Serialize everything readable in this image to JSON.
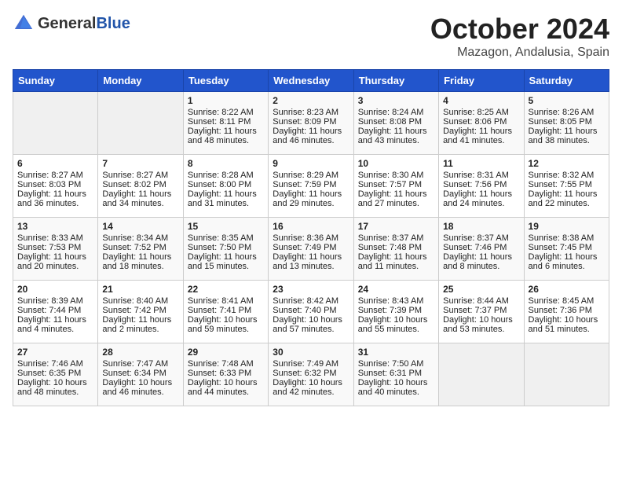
{
  "header": {
    "logo_general": "General",
    "logo_blue": "Blue",
    "month_title": "October 2024",
    "location": "Mazagon, Andalusia, Spain"
  },
  "weekdays": [
    "Sunday",
    "Monday",
    "Tuesday",
    "Wednesday",
    "Thursday",
    "Friday",
    "Saturday"
  ],
  "weeks": [
    [
      {
        "day": "",
        "sunrise": "",
        "sunset": "",
        "daylight": ""
      },
      {
        "day": "",
        "sunrise": "",
        "sunset": "",
        "daylight": ""
      },
      {
        "day": "1",
        "sunrise": "Sunrise: 8:22 AM",
        "sunset": "Sunset: 8:11 PM",
        "daylight": "Daylight: 11 hours and 48 minutes."
      },
      {
        "day": "2",
        "sunrise": "Sunrise: 8:23 AM",
        "sunset": "Sunset: 8:09 PM",
        "daylight": "Daylight: 11 hours and 46 minutes."
      },
      {
        "day": "3",
        "sunrise": "Sunrise: 8:24 AM",
        "sunset": "Sunset: 8:08 PM",
        "daylight": "Daylight: 11 hours and 43 minutes."
      },
      {
        "day": "4",
        "sunrise": "Sunrise: 8:25 AM",
        "sunset": "Sunset: 8:06 PM",
        "daylight": "Daylight: 11 hours and 41 minutes."
      },
      {
        "day": "5",
        "sunrise": "Sunrise: 8:26 AM",
        "sunset": "Sunset: 8:05 PM",
        "daylight": "Daylight: 11 hours and 38 minutes."
      }
    ],
    [
      {
        "day": "6",
        "sunrise": "Sunrise: 8:27 AM",
        "sunset": "Sunset: 8:03 PM",
        "daylight": "Daylight: 11 hours and 36 minutes."
      },
      {
        "day": "7",
        "sunrise": "Sunrise: 8:27 AM",
        "sunset": "Sunset: 8:02 PM",
        "daylight": "Daylight: 11 hours and 34 minutes."
      },
      {
        "day": "8",
        "sunrise": "Sunrise: 8:28 AM",
        "sunset": "Sunset: 8:00 PM",
        "daylight": "Daylight: 11 hours and 31 minutes."
      },
      {
        "day": "9",
        "sunrise": "Sunrise: 8:29 AM",
        "sunset": "Sunset: 7:59 PM",
        "daylight": "Daylight: 11 hours and 29 minutes."
      },
      {
        "day": "10",
        "sunrise": "Sunrise: 8:30 AM",
        "sunset": "Sunset: 7:57 PM",
        "daylight": "Daylight: 11 hours and 27 minutes."
      },
      {
        "day": "11",
        "sunrise": "Sunrise: 8:31 AM",
        "sunset": "Sunset: 7:56 PM",
        "daylight": "Daylight: 11 hours and 24 minutes."
      },
      {
        "day": "12",
        "sunrise": "Sunrise: 8:32 AM",
        "sunset": "Sunset: 7:55 PM",
        "daylight": "Daylight: 11 hours and 22 minutes."
      }
    ],
    [
      {
        "day": "13",
        "sunrise": "Sunrise: 8:33 AM",
        "sunset": "Sunset: 7:53 PM",
        "daylight": "Daylight: 11 hours and 20 minutes."
      },
      {
        "day": "14",
        "sunrise": "Sunrise: 8:34 AM",
        "sunset": "Sunset: 7:52 PM",
        "daylight": "Daylight: 11 hours and 18 minutes."
      },
      {
        "day": "15",
        "sunrise": "Sunrise: 8:35 AM",
        "sunset": "Sunset: 7:50 PM",
        "daylight": "Daylight: 11 hours and 15 minutes."
      },
      {
        "day": "16",
        "sunrise": "Sunrise: 8:36 AM",
        "sunset": "Sunset: 7:49 PM",
        "daylight": "Daylight: 11 hours and 13 minutes."
      },
      {
        "day": "17",
        "sunrise": "Sunrise: 8:37 AM",
        "sunset": "Sunset: 7:48 PM",
        "daylight": "Daylight: 11 hours and 11 minutes."
      },
      {
        "day": "18",
        "sunrise": "Sunrise: 8:37 AM",
        "sunset": "Sunset: 7:46 PM",
        "daylight": "Daylight: 11 hours and 8 minutes."
      },
      {
        "day": "19",
        "sunrise": "Sunrise: 8:38 AM",
        "sunset": "Sunset: 7:45 PM",
        "daylight": "Daylight: 11 hours and 6 minutes."
      }
    ],
    [
      {
        "day": "20",
        "sunrise": "Sunrise: 8:39 AM",
        "sunset": "Sunset: 7:44 PM",
        "daylight": "Daylight: 11 hours and 4 minutes."
      },
      {
        "day": "21",
        "sunrise": "Sunrise: 8:40 AM",
        "sunset": "Sunset: 7:42 PM",
        "daylight": "Daylight: 11 hours and 2 minutes."
      },
      {
        "day": "22",
        "sunrise": "Sunrise: 8:41 AM",
        "sunset": "Sunset: 7:41 PM",
        "daylight": "Daylight: 10 hours and 59 minutes."
      },
      {
        "day": "23",
        "sunrise": "Sunrise: 8:42 AM",
        "sunset": "Sunset: 7:40 PM",
        "daylight": "Daylight: 10 hours and 57 minutes."
      },
      {
        "day": "24",
        "sunrise": "Sunrise: 8:43 AM",
        "sunset": "Sunset: 7:39 PM",
        "daylight": "Daylight: 10 hours and 55 minutes."
      },
      {
        "day": "25",
        "sunrise": "Sunrise: 8:44 AM",
        "sunset": "Sunset: 7:37 PM",
        "daylight": "Daylight: 10 hours and 53 minutes."
      },
      {
        "day": "26",
        "sunrise": "Sunrise: 8:45 AM",
        "sunset": "Sunset: 7:36 PM",
        "daylight": "Daylight: 10 hours and 51 minutes."
      }
    ],
    [
      {
        "day": "27",
        "sunrise": "Sunrise: 7:46 AM",
        "sunset": "Sunset: 6:35 PM",
        "daylight": "Daylight: 10 hours and 48 minutes."
      },
      {
        "day": "28",
        "sunrise": "Sunrise: 7:47 AM",
        "sunset": "Sunset: 6:34 PM",
        "daylight": "Daylight: 10 hours and 46 minutes."
      },
      {
        "day": "29",
        "sunrise": "Sunrise: 7:48 AM",
        "sunset": "Sunset: 6:33 PM",
        "daylight": "Daylight: 10 hours and 44 minutes."
      },
      {
        "day": "30",
        "sunrise": "Sunrise: 7:49 AM",
        "sunset": "Sunset: 6:32 PM",
        "daylight": "Daylight: 10 hours and 42 minutes."
      },
      {
        "day": "31",
        "sunrise": "Sunrise: 7:50 AM",
        "sunset": "Sunset: 6:31 PM",
        "daylight": "Daylight: 10 hours and 40 minutes."
      },
      {
        "day": "",
        "sunrise": "",
        "sunset": "",
        "daylight": ""
      },
      {
        "day": "",
        "sunrise": "",
        "sunset": "",
        "daylight": ""
      }
    ]
  ]
}
